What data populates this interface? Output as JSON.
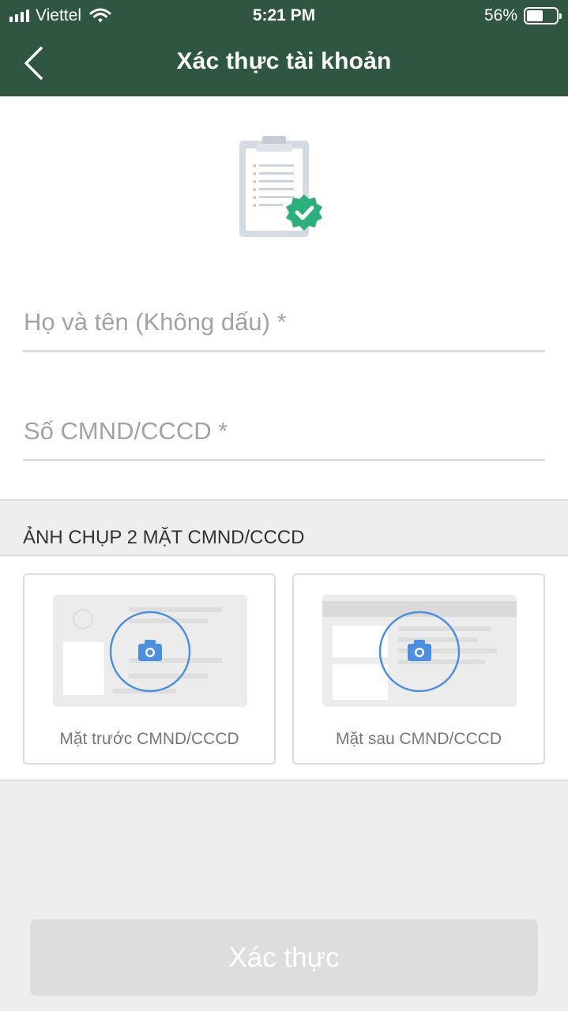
{
  "status_bar": {
    "carrier": "Viettel",
    "time": "5:21 PM",
    "battery_percent_label": "56%",
    "battery_level": 0.56
  },
  "nav": {
    "title": "Xác thực tài khoản",
    "back_icon": "chevron-left-icon"
  },
  "form": {
    "name_placeholder": "Họ và tên (Không dấu) *",
    "id_placeholder": "Số CMND/CCCD *"
  },
  "photos": {
    "section_title": "ẢNH CHỤP 2 MẶT CMND/CCCD",
    "front_label": "Mặt trước CMND/CCCD",
    "back_label": "Mặt sau CMND/CCCD",
    "camera_icon": "camera-icon"
  },
  "submit": {
    "label": "Xác thực"
  },
  "colors": {
    "header": "#2f5640",
    "badge": "#2bb07c",
    "camera": "#4a8fe0",
    "disabled_button": "#dddddd"
  }
}
